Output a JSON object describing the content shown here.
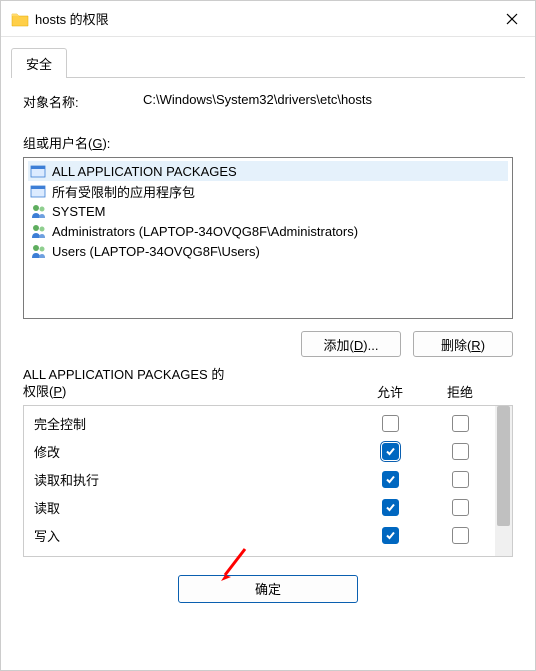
{
  "window": {
    "title": "hosts 的权限"
  },
  "tab": {
    "security": "安全"
  },
  "object": {
    "label": "对象名称:",
    "value": "C:\\Windows\\System32\\drivers\\etc\\hosts"
  },
  "groups": {
    "label_prefix": "组或用户名(",
    "label_key": "G",
    "label_suffix": "):",
    "items": [
      {
        "name": "ALL APPLICATION PACKAGES",
        "type": "package",
        "selected": true
      },
      {
        "name": "所有受限制的应用程序包",
        "type": "package",
        "selected": false
      },
      {
        "name": "SYSTEM",
        "type": "users",
        "selected": false
      },
      {
        "name": "Administrators (LAPTOP-34OVQG8F\\Administrators)",
        "type": "users",
        "selected": false
      },
      {
        "name": "Users (LAPTOP-34OVQG8F\\Users)",
        "type": "users",
        "selected": false
      }
    ]
  },
  "buttons": {
    "add_prefix": "添加(",
    "add_key": "D",
    "add_suffix": ")...",
    "remove_prefix": "删除(",
    "remove_key": "R",
    "remove_suffix": ")",
    "ok": "确定"
  },
  "permissions": {
    "title_line1": "ALL APPLICATION PACKAGES 的",
    "title_line2_prefix": "权限(",
    "title_line2_key": "P",
    "title_line2_suffix": ")",
    "allow": "允许",
    "deny": "拒绝",
    "items": [
      {
        "name": "完全控制",
        "allow": false,
        "deny": false,
        "highlighted": false
      },
      {
        "name": "修改",
        "allow": true,
        "deny": false,
        "highlighted": true
      },
      {
        "name": "读取和执行",
        "allow": true,
        "deny": false,
        "highlighted": false
      },
      {
        "name": "读取",
        "allow": true,
        "deny": false,
        "highlighted": false
      },
      {
        "name": "写入",
        "allow": true,
        "deny": false,
        "highlighted": false
      }
    ]
  }
}
